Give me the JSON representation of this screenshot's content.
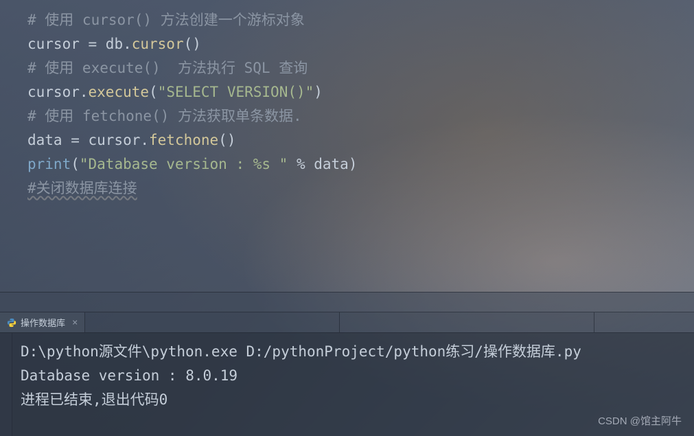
{
  "editor": {
    "lines": [
      {
        "type": "comment",
        "text": "# 使用 cursor() 方法创建一个游标对象"
      },
      {
        "type": "code",
        "segments": [
          {
            "class": "keyword",
            "text": "cursor "
          },
          {
            "class": "punct",
            "text": "= db."
          },
          {
            "class": "method",
            "text": "cursor"
          },
          {
            "class": "punct",
            "text": "()"
          }
        ]
      },
      {
        "type": "blank",
        "text": ""
      },
      {
        "type": "comment",
        "text": "# 使用 execute()  方法执行 SQL 查询"
      },
      {
        "type": "code",
        "segments": [
          {
            "class": "keyword",
            "text": "cursor."
          },
          {
            "class": "method",
            "text": "execute"
          },
          {
            "class": "punct",
            "text": "("
          },
          {
            "class": "string",
            "text": "\"SELECT VERSION()\""
          },
          {
            "class": "punct",
            "text": ")"
          }
        ]
      },
      {
        "type": "blank",
        "text": ""
      },
      {
        "type": "comment",
        "text": "# 使用 fetchone() 方法获取单条数据."
      },
      {
        "type": "code",
        "segments": [
          {
            "class": "keyword",
            "text": "data "
          },
          {
            "class": "punct",
            "text": "= cursor."
          },
          {
            "class": "method",
            "text": "fetchone"
          },
          {
            "class": "punct",
            "text": "()"
          }
        ]
      },
      {
        "type": "blank",
        "text": ""
      },
      {
        "type": "code",
        "segments": [
          {
            "class": "func",
            "text": "print"
          },
          {
            "class": "punct",
            "text": "("
          },
          {
            "class": "string",
            "text": "\"Database version : %s \""
          },
          {
            "class": "punct",
            "text": " % data)"
          }
        ]
      },
      {
        "type": "blank",
        "text": ""
      },
      {
        "type": "comment-wavy",
        "text": "#关闭数据库连接"
      }
    ]
  },
  "tab": {
    "label": "操作数据库",
    "close": "×"
  },
  "console": {
    "lines": [
      "D:\\python源文件\\python.exe D:/pythonProject/python练习/操作数据库.py",
      "Database version : 8.0.19",
      "",
      "进程已结束,退出代码0"
    ]
  },
  "watermark": "CSDN @馆主阿牛"
}
